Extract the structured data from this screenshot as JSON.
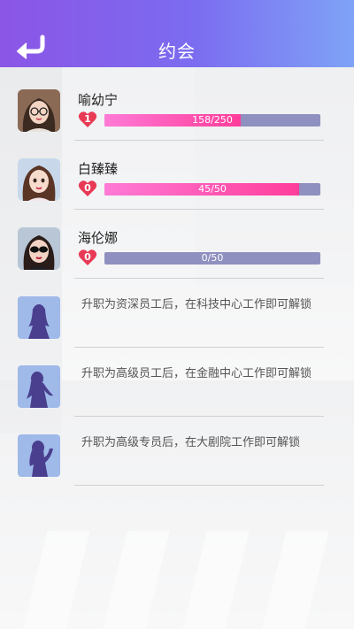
{
  "header": {
    "title": "约会",
    "back_icon": "back-arrow-icon"
  },
  "characters": [
    {
      "name": "喻幼宁",
      "level": "1",
      "progress_text": "158/250",
      "progress": 0.632,
      "avatar": "avatar-glasses-girl"
    },
    {
      "name": "白臻臻",
      "level": "0",
      "progress_text": "45/50",
      "progress": 0.9,
      "avatar": "avatar-long-hair-girl"
    },
    {
      "name": "海伦娜",
      "level": "0",
      "progress_text": "0/50",
      "progress": 0.0,
      "avatar": "avatar-sunglasses-girl"
    }
  ],
  "locked": [
    {
      "text": "升职为资深员工后，在科技中心工作即可解锁",
      "icon": "locked-silhouette-icon"
    },
    {
      "text": "升职为高级员工后，在金融中心工作即可解锁",
      "icon": "locked-silhouette-icon"
    },
    {
      "text": "升职为高级专员后，在大剧院工作即可解锁",
      "icon": "locked-silhouette-icon"
    }
  ],
  "colors": {
    "header_start": "#8b55e6",
    "header_end": "#7fa3f7",
    "bar_bg": "#8f90c0",
    "bar_fill": "#ff3d9a",
    "heart": "#e83a55"
  }
}
